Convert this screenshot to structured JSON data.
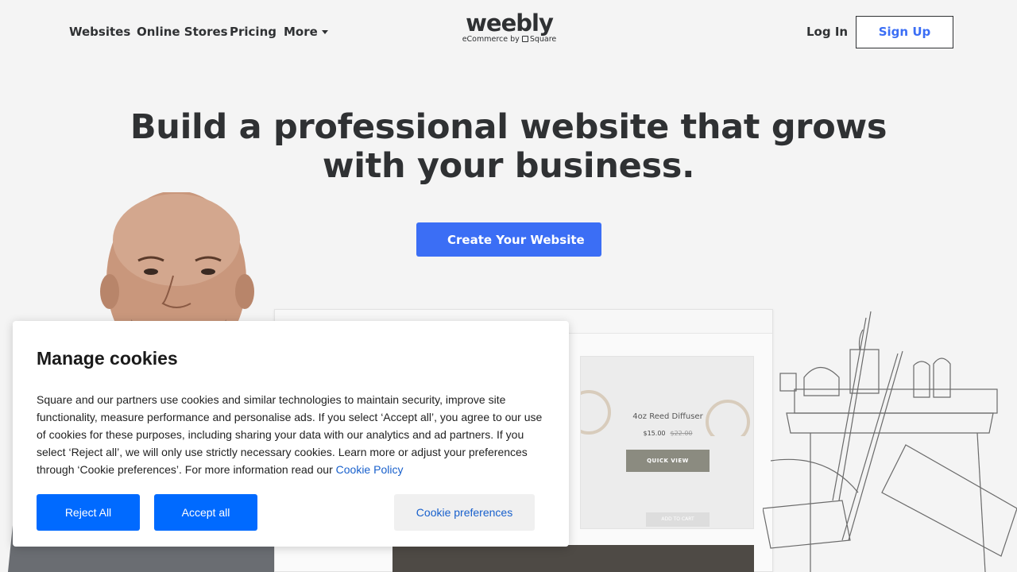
{
  "nav": {
    "websites": "Websites",
    "online_stores": "Online Stores",
    "pricing": "Pricing",
    "more": "More",
    "login": "Log In",
    "signup": "Sign Up"
  },
  "logo": {
    "wordmark": "weebly",
    "tagline_prefix": "eCommerce by",
    "tagline_brand": "Square"
  },
  "hero": {
    "title_line1": "Build a professional website that grows",
    "title_line2": "with your business.",
    "cta": "Create Your Website"
  },
  "mockup": {
    "product_name": "4oz Reed Diffuser",
    "price": "$15.00",
    "old_price": "$22.00",
    "quick_view": "QUICK VIEW",
    "add_to_cart": "ADD TO CART"
  },
  "cookie": {
    "title": "Manage cookies",
    "body": "Square and our partners use cookies and similar technologies to maintain security, improve site functionality, measure performance and personalise ads. If you select ‘Accept all’, you agree to our use of cookies for these purposes, including sharing your data with our analytics and ad partners. If you select ‘Reject all’, we will only use strictly necessary cookies. Learn more or adjust your preferences through ‘Cookie preferences’. For more information read our",
    "policy_link": "Cookie Policy",
    "reject": "Reject All",
    "accept": "Accept all",
    "preferences": "Cookie preferences"
  },
  "colors": {
    "brand_blue": "#3b6ef5",
    "cookie_blue": "#006aff",
    "link_blue": "#1860cc",
    "text_dark": "#2f3133",
    "background": "#f4f4f4"
  }
}
